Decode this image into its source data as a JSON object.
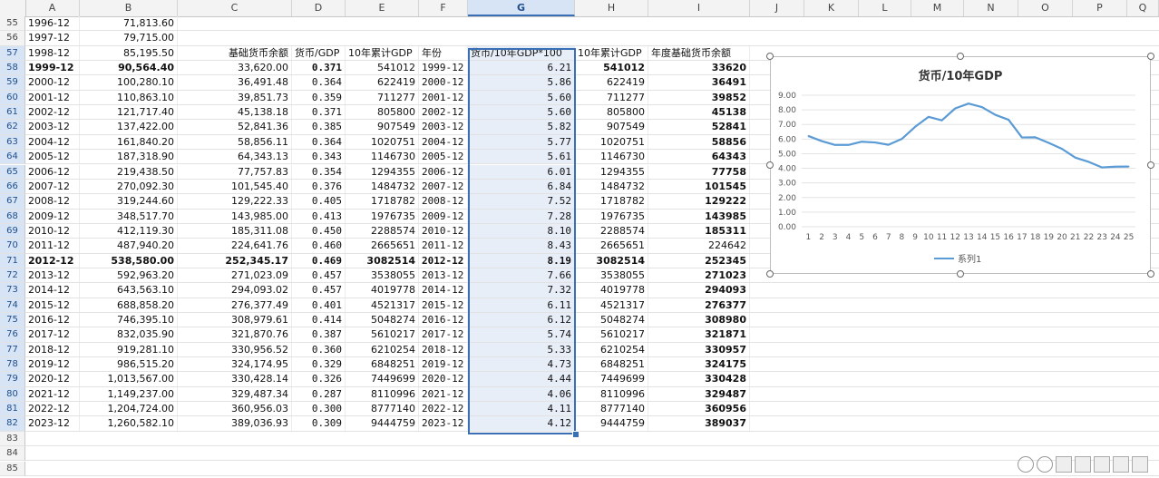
{
  "columns": [
    "A",
    "B",
    "C",
    "D",
    "E",
    "F",
    "G",
    "H",
    "I",
    "J",
    "K",
    "L",
    "M",
    "N",
    "O",
    "P",
    "Q"
  ],
  "selected_column": "G",
  "header_row": {
    "row_num": "57",
    "A": "1998-12",
    "B": "85,195.50",
    "C": "基础货币余额",
    "D": "货币/GDP",
    "E": "10年累计GDP",
    "F": "年份",
    "G": "货币/10年GDP*100",
    "H": "10年累计GDP",
    "I": "年度基础货币余额"
  },
  "rows_pre": [
    {
      "n": "55",
      "A": "1996-12",
      "B": "71,813.60"
    },
    {
      "n": "56",
      "A": "1997-12",
      "B": "79,715.00"
    }
  ],
  "rows": [
    {
      "n": "58",
      "A": "1999-12",
      "B": "90,564.40",
      "C": "33,620.00",
      "D": "0.371",
      "E": "541012",
      "F": "1999-12",
      "G": "6.21",
      "H": "541012",
      "I": "33620",
      "bold": true
    },
    {
      "n": "59",
      "A": "2000-12",
      "B": "100,280.10",
      "C": "36,491.48",
      "D": "0.364",
      "E": "622419",
      "F": "2000-12",
      "G": "5.86",
      "H": "622419",
      "I": "36491"
    },
    {
      "n": "60",
      "A": "2001-12",
      "B": "110,863.10",
      "C": "39,851.73",
      "D": "0.359",
      "E": "711277",
      "F": "2001-12",
      "G": "5.60",
      "H": "711277",
      "I": "39852"
    },
    {
      "n": "61",
      "A": "2002-12",
      "B": "121,717.40",
      "C": "45,138.18",
      "D": "0.371",
      "E": "805800",
      "F": "2002-12",
      "G": "5.60",
      "H": "805800",
      "I": "45138"
    },
    {
      "n": "62",
      "A": "2003-12",
      "B": "137,422.00",
      "C": "52,841.36",
      "D": "0.385",
      "E": "907549",
      "F": "2003-12",
      "G": "5.82",
      "H": "907549",
      "I": "52841"
    },
    {
      "n": "63",
      "A": "2004-12",
      "B": "161,840.20",
      "C": "58,856.11",
      "D": "0.364",
      "E": "1020751",
      "F": "2004-12",
      "G": "5.77",
      "H": "1020751",
      "I": "58856"
    },
    {
      "n": "64",
      "A": "2005-12",
      "B": "187,318.90",
      "C": "64,343.13",
      "D": "0.343",
      "E": "1146730",
      "F": "2005-12",
      "G": "5.61",
      "H": "1146730",
      "I": "64343"
    },
    {
      "n": "65",
      "A": "2006-12",
      "B": "219,438.50",
      "C": "77,757.83",
      "D": "0.354",
      "E": "1294355",
      "F": "2006-12",
      "G": "6.01",
      "H": "1294355",
      "I": "77758"
    },
    {
      "n": "66",
      "A": "2007-12",
      "B": "270,092.30",
      "C": "101,545.40",
      "D": "0.376",
      "E": "1484732",
      "F": "2007-12",
      "G": "6.84",
      "H": "1484732",
      "I": "101545"
    },
    {
      "n": "67",
      "A": "2008-12",
      "B": "319,244.60",
      "C": "129,222.33",
      "D": "0.405",
      "E": "1718782",
      "F": "2008-12",
      "G": "7.52",
      "H": "1718782",
      "I": "129222"
    },
    {
      "n": "68",
      "A": "2009-12",
      "B": "348,517.70",
      "C": "143,985.00",
      "D": "0.413",
      "E": "1976735",
      "F": "2009-12",
      "G": "7.28",
      "H": "1976735",
      "I": "143985"
    },
    {
      "n": "69",
      "A": "2010-12",
      "B": "412,119.30",
      "C": "185,311.08",
      "D": "0.450",
      "E": "2288574",
      "F": "2010-12",
      "G": "8.10",
      "H": "2288574",
      "I": "185311"
    },
    {
      "n": "70",
      "A": "2011-12",
      "B": "487,940.20",
      "C": "224,641.76",
      "D": "0.460",
      "E": "2665651",
      "F": "2011-12",
      "G": "8.43",
      "H": "2665651",
      "I": "224642",
      "i_normal": true
    },
    {
      "n": "71",
      "A": "2012-12",
      "B": "538,580.00",
      "C": "252,345.17",
      "D": "0.469",
      "E": "3082514",
      "F": "2012-12",
      "G": "8.19",
      "H": "3082514",
      "I": "252345",
      "bold": true,
      "allbold": true
    },
    {
      "n": "72",
      "A": "2013-12",
      "B": "592,963.20",
      "C": "271,023.09",
      "D": "0.457",
      "E": "3538055",
      "F": "2013-12",
      "G": "7.66",
      "H": "3538055",
      "I": "271023"
    },
    {
      "n": "73",
      "A": "2014-12",
      "B": "643,563.10",
      "C": "294,093.02",
      "D": "0.457",
      "E": "4019778",
      "F": "2014-12",
      "G": "7.32",
      "H": "4019778",
      "I": "294093"
    },
    {
      "n": "74",
      "A": "2015-12",
      "B": "688,858.20",
      "C": "276,377.49",
      "D": "0.401",
      "E": "4521317",
      "F": "2015-12",
      "G": "6.11",
      "H": "4521317",
      "I": "276377"
    },
    {
      "n": "75",
      "A": "2016-12",
      "B": "746,395.10",
      "C": "308,979.61",
      "D": "0.414",
      "E": "5048274",
      "F": "2016-12",
      "G": "6.12",
      "H": "5048274",
      "I": "308980"
    },
    {
      "n": "76",
      "A": "2017-12",
      "B": "832,035.90",
      "C": "321,870.76",
      "D": "0.387",
      "E": "5610217",
      "F": "2017-12",
      "G": "5.74",
      "H": "5610217",
      "I": "321871"
    },
    {
      "n": "77",
      "A": "2018-12",
      "B": "919,281.10",
      "C": "330,956.52",
      "D": "0.360",
      "E": "6210254",
      "F": "2018-12",
      "G": "5.33",
      "H": "6210254",
      "I": "330957"
    },
    {
      "n": "78",
      "A": "2019-12",
      "B": "986,515.20",
      "C": "324,174.95",
      "D": "0.329",
      "E": "6848251",
      "F": "2019-12",
      "G": "4.73",
      "H": "6848251",
      "I": "324175"
    },
    {
      "n": "79",
      "A": "2020-12",
      "B": "1,013,567.00",
      "C": "330,428.14",
      "D": "0.326",
      "E": "7449699",
      "F": "2020-12",
      "G": "4.44",
      "H": "7449699",
      "I": "330428"
    },
    {
      "n": "80",
      "A": "2021-12",
      "B": "1,149,237.00",
      "C": "329,487.34",
      "D": "0.287",
      "E": "8110996",
      "F": "2021-12",
      "G": "4.06",
      "H": "8110996",
      "I": "329487"
    },
    {
      "n": "81",
      "A": "2022-12",
      "B": "1,204,724.00",
      "C": "360,956.03",
      "D": "0.300",
      "E": "8777140",
      "F": "2022-12",
      "G": "4.11",
      "H": "8777140",
      "I": "360956"
    },
    {
      "n": "82",
      "A": "2023-12",
      "B": "1,260,582.10",
      "C": "389,036.93",
      "D": "0.309",
      "E": "9444759",
      "F": "2023-12",
      "G": "4.12",
      "H": "9444759",
      "I": "389037"
    }
  ],
  "rows_post": [
    {
      "n": "83"
    },
    {
      "n": "84"
    },
    {
      "n": "85"
    }
  ],
  "chart_data": {
    "type": "line",
    "title": "货币/10年GDP",
    "x": [
      1,
      2,
      3,
      4,
      5,
      6,
      7,
      8,
      9,
      10,
      11,
      12,
      13,
      14,
      15,
      16,
      17,
      18,
      19,
      20,
      21,
      22,
      23,
      24,
      25
    ],
    "series": [
      {
        "name": "系列1",
        "values": [
          6.21,
          5.86,
          5.6,
          5.6,
          5.82,
          5.77,
          5.61,
          6.01,
          6.84,
          7.52,
          7.28,
          8.1,
          8.43,
          8.19,
          7.66,
          7.32,
          6.11,
          6.12,
          5.74,
          5.33,
          4.73,
          4.44,
          4.06,
          4.11,
          4.12
        ]
      }
    ],
    "y_ticks": [
      "0.00",
      "1.00",
      "2.00",
      "3.00",
      "4.00",
      "5.00",
      "6.00",
      "7.00",
      "8.00",
      "9.00"
    ],
    "ylim": [
      0,
      9
    ],
    "grid": true,
    "legend": "bottom",
    "color": "#5b9bd5"
  }
}
